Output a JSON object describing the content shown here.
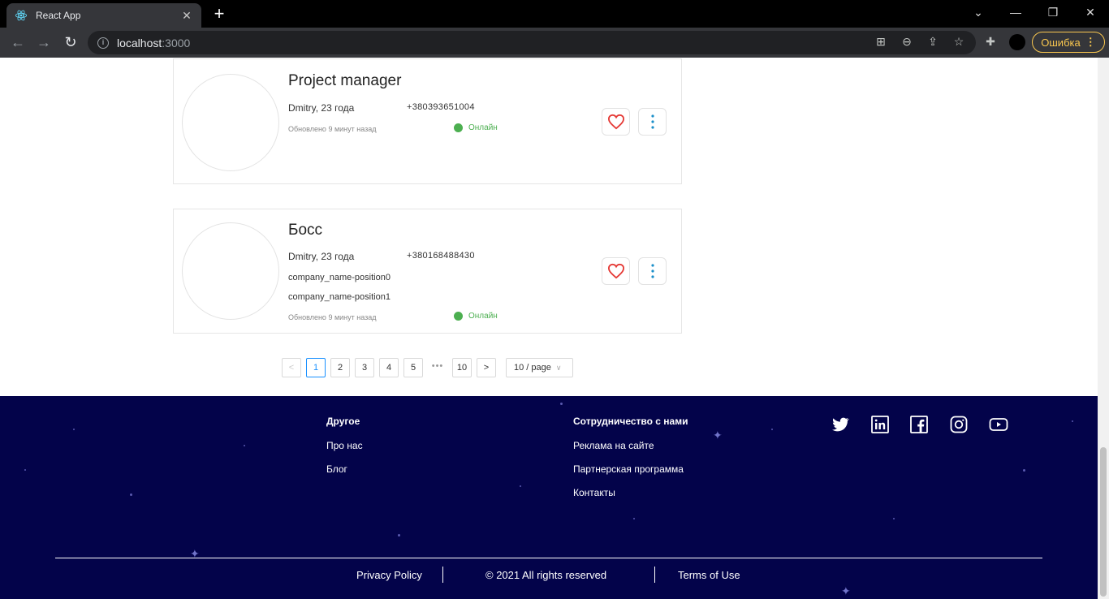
{
  "browser": {
    "tab_title": "React App",
    "url_host": "localhost",
    "url_port": ":3000",
    "error_label": "Ошибка"
  },
  "cards": [
    {
      "title": "Project manager",
      "name": "Dmitry, 23 года",
      "phone": "+380393651004",
      "companies": [],
      "updated": "Обновлено 9 минут назад",
      "status": "Онлайн"
    },
    {
      "title": "Босс",
      "name": "Dmitry, 23 года",
      "phone": "+380168488430",
      "companies": [
        "company_name-position0",
        "company_name-position1"
      ],
      "updated": "Обновлено 9 минут назад",
      "status": "Онлайн"
    }
  ],
  "pagination": {
    "prev": "<",
    "pages": [
      "1",
      "2",
      "3",
      "4",
      "5"
    ],
    "ellipsis": "•••",
    "last": "10",
    "next": ">",
    "current": "1",
    "page_size": "10 / page"
  },
  "footer": {
    "col1": {
      "heading": "Другое",
      "links": [
        "Про нас",
        "Блог"
      ]
    },
    "col2": {
      "heading": "Сотрудничество с нами",
      "links": [
        "Реклама на сайте",
        "Партнерская программа",
        "Контакты"
      ]
    },
    "social": [
      "twitter-icon",
      "linkedin-icon",
      "facebook-icon",
      "instagram-icon",
      "youtube-icon"
    ],
    "privacy": "Privacy Policy",
    "copyright": "© 2021 All rights reserved",
    "terms": "Terms of Use"
  },
  "colors": {
    "footer_bg": "#03034a",
    "online": "#4caf50",
    "heart": "#e53935",
    "more": "#1a8fc9",
    "active_page": "#1890ff"
  }
}
